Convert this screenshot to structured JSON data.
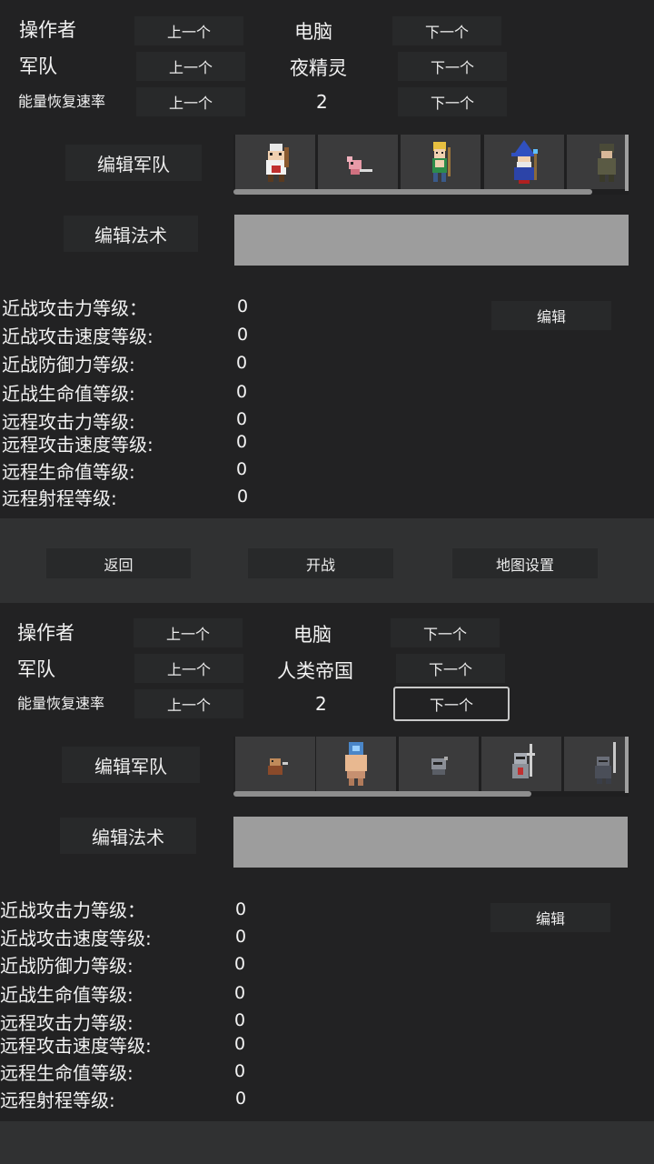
{
  "panels": [
    {
      "operator_label": "操作者",
      "operator_value": "电脑",
      "army_label": "军队",
      "army_value": "夜精灵",
      "energy_label": "能量恢复速率",
      "energy_value": "2",
      "prev_label": "上一个",
      "next_label": "下一个",
      "edit_army_label": "编辑军队",
      "edit_spell_label": "编辑法术",
      "edit_label": "编辑",
      "units": [
        "white-hood-unit-icon",
        "pink-creature-unit-icon",
        "elf-archer-unit-icon",
        "blue-wizard-unit-icon",
        "dark-ranger-unit-icon"
      ],
      "stats": [
        {
          "label": "近战攻击力等级：",
          "value": "0"
        },
        {
          "label": "近战攻击速度等级:",
          "value": "0"
        },
        {
          "label": "近战防御力等级:",
          "value": "0"
        },
        {
          "label": "近战生命值等级:",
          "value": "0"
        },
        {
          "label": "远程攻击力等级:",
          "value": "0"
        },
        {
          "label": "远程攻击速度等级:",
          "value": "0"
        },
        {
          "label": "远程生命值等级:",
          "value": "0"
        },
        {
          "label": "远程射程等级:",
          "value": "0"
        }
      ]
    },
    {
      "operator_label": "操作者",
      "operator_value": "电脑",
      "army_label": "军队",
      "army_value": "人类帝国",
      "energy_label": "能量恢复速率",
      "energy_value": "2",
      "prev_label": "上一个",
      "next_label": "下一个",
      "edit_army_label": "编辑军队",
      "edit_spell_label": "编辑法术",
      "edit_label": "编辑",
      "units": [
        "peasant-unit-icon",
        "blue-helmet-warrior-unit-icon",
        "helmet-soldier-unit-icon",
        "knight-unit-icon",
        "swordsman-unit-icon"
      ],
      "stats": [
        {
          "label": "近战攻击力等级：",
          "value": "0"
        },
        {
          "label": "近战攻击速度等级:",
          "value": "0"
        },
        {
          "label": "近战防御力等级:",
          "value": "0"
        },
        {
          "label": "近战生命值等级:",
          "value": "0"
        },
        {
          "label": "远程攻击力等级:",
          "value": "0"
        },
        {
          "label": "远程攻击速度等级:",
          "value": "0"
        },
        {
          "label": "远程生命值等级:",
          "value": "0"
        },
        {
          "label": "远程射程等级:",
          "value": "0"
        }
      ]
    }
  ],
  "middle": {
    "back_label": "返回",
    "start_label": "开战",
    "map_settings_label": "地图设置"
  },
  "colors": {
    "panel_bg": "#222223",
    "page_bg": "#303132",
    "button_bg": "#28292a",
    "spell_box": "#9d9d9d"
  }
}
